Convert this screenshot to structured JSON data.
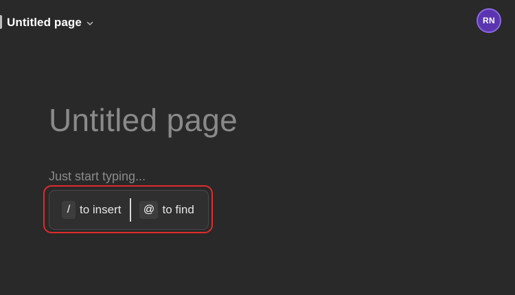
{
  "header": {
    "page_selector_label": "Untitled page",
    "avatar_initials": "RN",
    "avatar_color": "#5b35b0"
  },
  "editor": {
    "page_title_placeholder": "Untitled page",
    "body_placeholder": "Just start typing...",
    "hints": [
      {
        "key": "/",
        "text": "to insert"
      },
      {
        "key": "@",
        "text": "to find"
      }
    ]
  },
  "colors": {
    "background": "#292929",
    "highlight_outline": "#e32b2b"
  }
}
